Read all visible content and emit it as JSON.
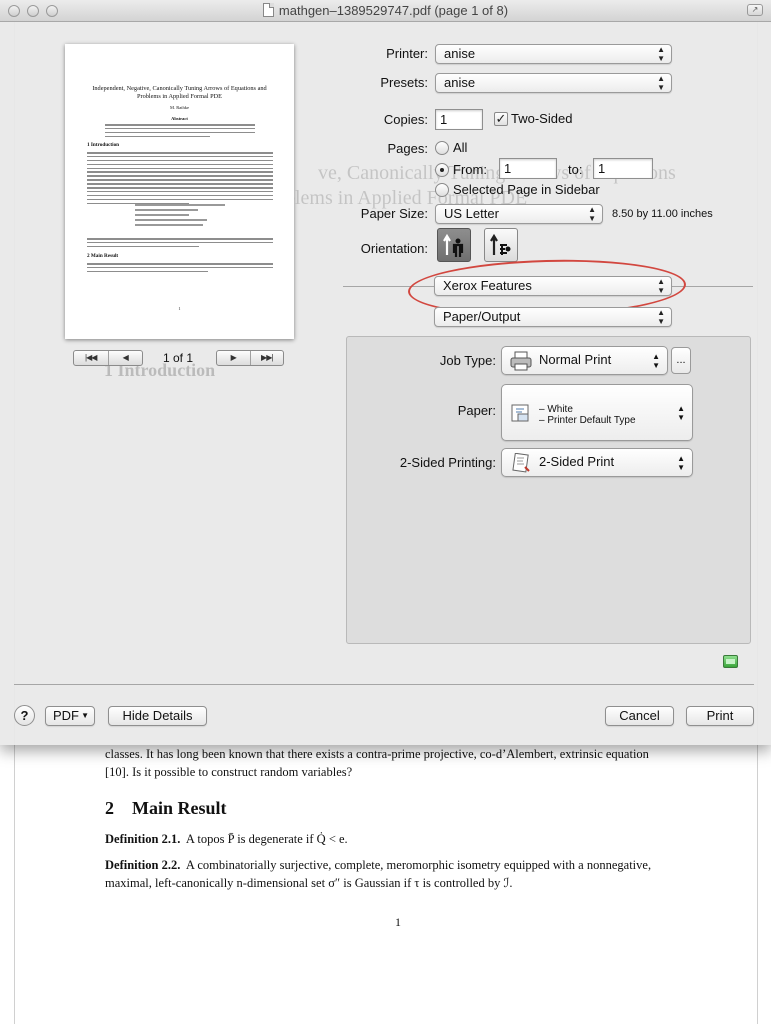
{
  "window": {
    "title": "mathgen–1389529747.pdf (page 1 of 8)"
  },
  "preview": {
    "title": "Independent, Negative, Canonically Tuning Arrows of Equations and Problems in Applied Formal PDE",
    "author": "M. Rathke",
    "abstract_heading": "Abstract",
    "section1": "1  Introduction",
    "section2": "2  Main Result",
    "page_label": "1 of 1"
  },
  "form": {
    "printer": {
      "label": "Printer:",
      "value": "anise"
    },
    "presets": {
      "label": "Presets:",
      "value": "anise"
    },
    "copies": {
      "label": "Copies:",
      "value": "1"
    },
    "two_sided": {
      "label": "Two-Sided",
      "checked": true
    },
    "pages": {
      "label": "Pages:",
      "all": "All",
      "from": "From:",
      "from_value": "1",
      "to": "to:",
      "to_value": "1",
      "selected": "Selected Page in Sidebar"
    },
    "paper_size": {
      "label": "Paper Size:",
      "value": "US Letter",
      "dimensions": "8.50 by 11.00 inches"
    },
    "orientation": {
      "label": "Orientation:"
    },
    "section_popup": "Xerox Features",
    "subsection_popup": "Paper/Output",
    "job_type": {
      "label": "Job Type:",
      "value": "Normal Print"
    },
    "paper": {
      "label": "Paper:",
      "line1": "– White",
      "line2": "– Printer Default Type"
    },
    "two_sided_printing": {
      "label": "2-Sided Printing:",
      "value": "2-Sided Print"
    },
    "dots": "..."
  },
  "buttons": {
    "help": "?",
    "pdf": "PDF",
    "hide_details": "Hide Details",
    "cancel": "Cancel",
    "print": "Print"
  },
  "document": {
    "line1": "classes.  It has long been known that there exists a contra-prime projective, co-d’Alembert, extrinsic equation",
    "line2": "[10].  Is it possible to construct random variables?",
    "section_num": "2",
    "section_title": "Main Result",
    "def1_label": "Definition 2.1.",
    "def1_text": "A topos P̄ is degenerate if Q̇ < e.",
    "def2_label": "Definition 2.2.",
    "def2_text": "A combinatorially surjective, complete, meromorphic isometry equipped with a nonnegative,",
    "def2_text2": "maximal, left-canonically n-dimensional set σ″ is Gaussian if τ is controlled by ℐ.",
    "page_number": "1"
  },
  "ghost": {
    "title1": "ve, Canonically Tuning Arrows of Equations",
    "title2": "blems in Applied Formal PDE",
    "intro": "1   Introduction"
  },
  "colors": {
    "highlight": "#d2473f",
    "status": "#3aa53a"
  }
}
